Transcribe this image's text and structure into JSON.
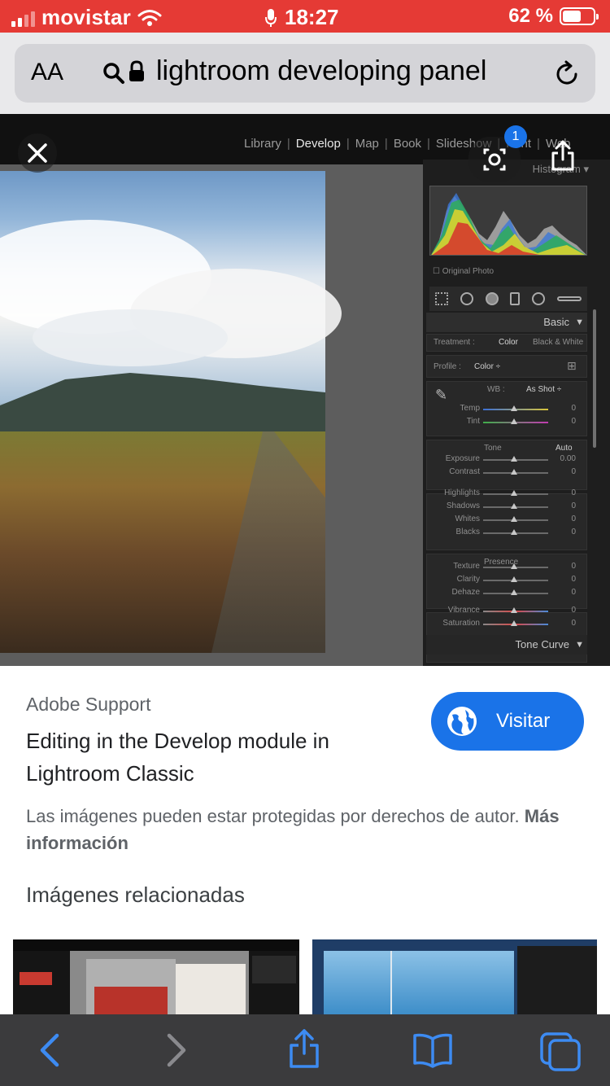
{
  "status": {
    "carrier": "movistar",
    "time": "18:27",
    "battery_pct": "62 %",
    "battery_level": 0.62
  },
  "address": {
    "aa_label": "AA",
    "query": "lightroom developing panel"
  },
  "viewer": {
    "badge_count": "1",
    "lightroom": {
      "modules": [
        "Library",
        "Develop",
        "Map",
        "Book",
        "Slideshow",
        "Print",
        "Web"
      ],
      "active_module": "Develop",
      "histogram_label": "Histogram",
      "original_photo_label": "Original Photo",
      "basic_label": "Basic",
      "treatment_label": "Treatment :",
      "treatment_color": "Color",
      "treatment_bw": "Black & White",
      "profile_label": "Profile :",
      "profile_value": "Color ÷",
      "wb_label": "WB :",
      "wb_value": "As Shot ÷",
      "tone_label": "Tone",
      "auto_label": "Auto",
      "presence_label": "Presence",
      "tone_curve_label": "Tone Curve",
      "sliders": [
        {
          "label": "Temp",
          "value": "0"
        },
        {
          "label": "Tint",
          "value": "0"
        },
        {
          "label": "Exposure",
          "value": "0.00"
        },
        {
          "label": "Contrast",
          "value": "0"
        },
        {
          "label": "Highlights",
          "value": "0"
        },
        {
          "label": "Shadows",
          "value": "0"
        },
        {
          "label": "Whites",
          "value": "0"
        },
        {
          "label": "Blacks",
          "value": "0"
        },
        {
          "label": "Texture",
          "value": "0"
        },
        {
          "label": "Clarity",
          "value": "0"
        },
        {
          "label": "Dehaze",
          "value": "0"
        },
        {
          "label": "Vibrance",
          "value": "0"
        },
        {
          "label": "Saturation",
          "value": "0"
        }
      ]
    }
  },
  "result": {
    "source": "Adobe Support",
    "title": "Editing in the Develop module in Lightroom Classic",
    "visit_label": "Visitar",
    "copyright_text": "Las imágenes pueden estar protegidas por derechos de autor.",
    "more_info": "Más información",
    "related_heading": "Imágenes relacionadas"
  },
  "colors": {
    "status_bar": "#e53a35",
    "accent": "#1a73e8",
    "toolbar": "#3b3b3d",
    "toolbar_icon": "#3d8bf2"
  }
}
